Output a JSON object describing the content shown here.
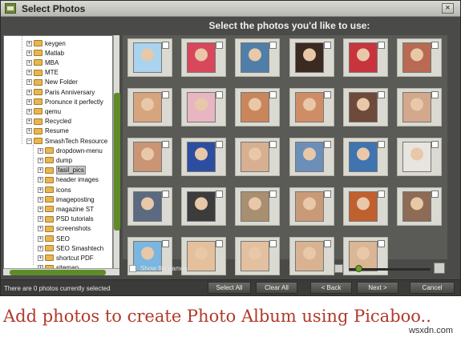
{
  "window": {
    "title": "Select Photos",
    "close_label": "×"
  },
  "instruction": "Select the photos you'd like to use:",
  "tree": {
    "items": [
      {
        "label": "keygen",
        "level": 1
      },
      {
        "label": "Matlab",
        "level": 1
      },
      {
        "label": "MBA",
        "level": 1
      },
      {
        "label": "MTE",
        "level": 1
      },
      {
        "label": "New Folder",
        "level": 1
      },
      {
        "label": "Paris Anniversary",
        "level": 1
      },
      {
        "label": "Pronunce it perfectly",
        "level": 1
      },
      {
        "label": "qemu",
        "level": 1
      },
      {
        "label": "Recycled",
        "level": 1
      },
      {
        "label": "Resume",
        "level": 1
      },
      {
        "label": "SmashTech Resource",
        "level": 1,
        "expanded": true
      },
      {
        "label": "dropdown-menu",
        "level": 2
      },
      {
        "label": "dump",
        "level": 2
      },
      {
        "label": "fasil_pics",
        "level": 2,
        "selected": true
      },
      {
        "label": "header images",
        "level": 2
      },
      {
        "label": "icons",
        "level": 2
      },
      {
        "label": "imageposting",
        "level": 2
      },
      {
        "label": "magazine ST",
        "level": 2
      },
      {
        "label": "PSD tutorials",
        "level": 2
      },
      {
        "label": "screenshots",
        "level": 2
      },
      {
        "label": "SEO",
        "level": 2
      },
      {
        "label": "SEO Smashtech",
        "level": 2
      },
      {
        "label": "shortcut PDF",
        "level": 2
      },
      {
        "label": "sitemap",
        "level": 2
      }
    ]
  },
  "photos": [
    {
      "fill": "#a9d3ef"
    },
    {
      "fill": "#d9475a"
    },
    {
      "fill": "#4f7fa8"
    },
    {
      "fill": "#3a2a22"
    },
    {
      "fill": "#c8343d"
    },
    {
      "fill": "#b86a52"
    },
    {
      "fill": "#d6a57e"
    },
    {
      "fill": "#e7b6c2"
    },
    {
      "fill": "#c9865b"
    },
    {
      "fill": "#cf8d66"
    },
    {
      "fill": "#6e4a3a"
    },
    {
      "fill": "#d4a88c"
    },
    {
      "fill": "#c99575"
    },
    {
      "fill": "#2d4da0"
    },
    {
      "fill": "#d6b090"
    },
    {
      "fill": "#6b8fb8"
    },
    {
      "fill": "#3f74b0"
    },
    {
      "fill": "#e8e4e0"
    },
    {
      "fill": "#5b6a80"
    },
    {
      "fill": "#3c3c3c"
    },
    {
      "fill": "#a88f70"
    },
    {
      "fill": "#c89a78"
    },
    {
      "fill": "#c0602f"
    },
    {
      "fill": "#8d6b55"
    },
    {
      "fill": "#7ab6df"
    },
    {
      "fill": "#e4c19c"
    },
    {
      "fill": "#e2c0a0"
    },
    {
      "fill": "#d9b391"
    },
    {
      "fill": "#dbb694"
    }
  ],
  "show_file_names": "Show file names",
  "zoom_level": 0.08,
  "status": "There are 0 photos currently selected",
  "buttons": {
    "select_all": "Select All",
    "clear_all": "Clear All",
    "back": "< Back",
    "next": "Next >",
    "cancel": "Cancel"
  },
  "caption": "Add photos to create Photo Album using Picaboo..",
  "watermark": "wsxdn.com"
}
